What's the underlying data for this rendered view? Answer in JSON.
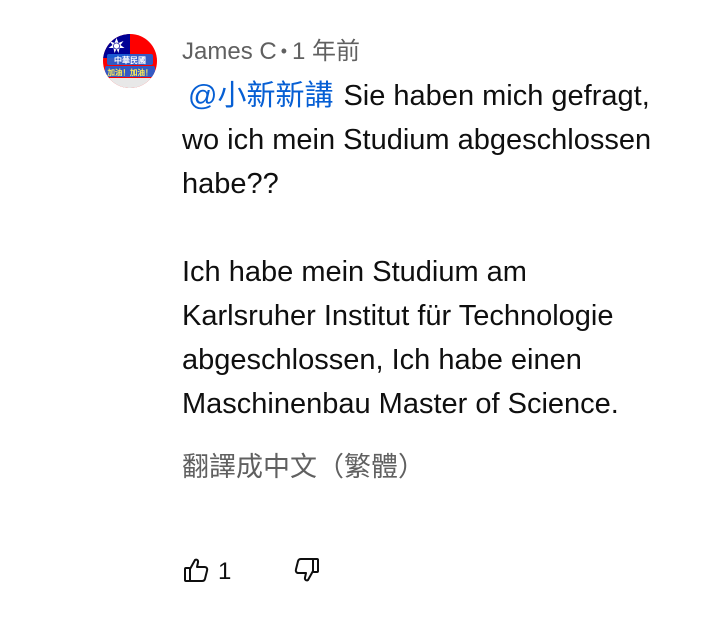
{
  "comment": {
    "author": "James C",
    "separator": "•",
    "time": "1 年前",
    "mention": "@小新新講",
    "lines": [
      "Sie haben mich gefragt,",
      "wo ich mein Studium abgeschlossen",
      "habe??",
      "Ich habe mein Studium am",
      "Karlsruher Institut für Technologie",
      "abgeschlossen,  Ich habe einen",
      "Maschinenbau Master of Science."
    ],
    "translate_label": "翻譯成中文（繁體）",
    "like_count": "1",
    "avatar_text_top": "中華民國",
    "avatar_text_bottom": "加油！加油！"
  },
  "colors": {
    "mention": "#065fd4",
    "meta_text": "#606060",
    "body_text": "#0f0f0f",
    "flag_red": "#fe0000",
    "flag_blue": "#000095"
  },
  "icons": {
    "like": "thumbs-up-icon",
    "dislike": "thumbs-down-icon"
  }
}
